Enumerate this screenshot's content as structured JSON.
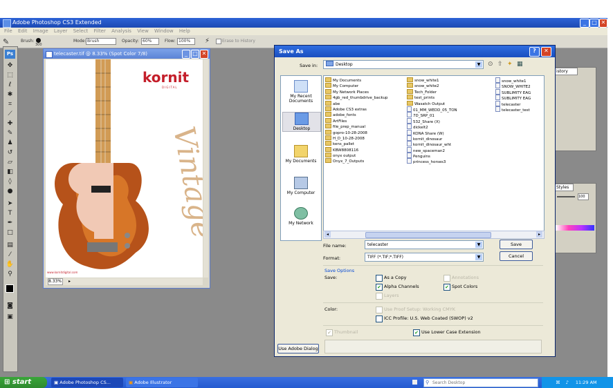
{
  "app": {
    "title": "Adobe Photoshop CS3 Extended",
    "menus": [
      "File",
      "Edit",
      "Image",
      "Layer",
      "Select",
      "Filter",
      "Analysis",
      "View",
      "Window",
      "Help"
    ],
    "options_bar": {
      "brush_label": "Brush:",
      "brush_size": "300",
      "mode_label": "Mode:",
      "mode_value": "Brush",
      "opacity_label": "Opacity:",
      "opacity_value": "60%",
      "flow_label": "Flow:",
      "flow_value": "100%",
      "erase_history_label": "Erase to History"
    },
    "ps_badge": "Ps"
  },
  "document": {
    "title": "telecaster.tif @ 8.33% (Spot Color 7/8)",
    "zoom": "8.33%",
    "brand_text": "kornit",
    "brand_sub": "DIGITAL",
    "script_text": "Vintage",
    "footer_url": "www.kornitdigital.com"
  },
  "dialog": {
    "title": "Save As",
    "save_in_label": "Save in:",
    "save_in_value": "Desktop",
    "places": [
      "My Recent Documents",
      "Desktop",
      "My Documents",
      "My Computer",
      "My Network"
    ],
    "files_col1": [
      "My Documents",
      "My Computer",
      "My Network Places",
      "4gb_red_thumbdrive_backup",
      "abe",
      "Adobe CS3 extras",
      "adobe_fonts",
      "ArtFiles",
      "file_prep_manual",
      "gopro-10-28-2008",
      "H_D_10-28-2008",
      "kens_pallet",
      "KBW8808116",
      "onyx output",
      "Onyx_7_Outputs"
    ],
    "files_col1_types": [
      "fold",
      "fold",
      "fold",
      "fold",
      "fold",
      "fold",
      "fold",
      "fold",
      "fold",
      "fold",
      "fold",
      "fold",
      "fold",
      "fold",
      "fold"
    ],
    "files_col2": [
      "snow_white1",
      "snow_white2",
      "Tech_Folder",
      "test_prints",
      "Wasatch Output",
      "01_MM_WEDD_05_TON",
      "7D_SRP_01",
      "532_Share (X)",
      "dickelt2",
      "KONA Share (W)",
      "kornit_dinosaur",
      "kornit_dinosaur_wht",
      "new_spaceman2",
      "Penguins",
      "princess_horses3"
    ],
    "files_col2_types": [
      "fold",
      "fold",
      "fold",
      "fold",
      "fold",
      "file",
      "file",
      "file",
      "file",
      "file",
      "file",
      "file",
      "file",
      "file",
      "file"
    ],
    "files_col3": [
      "snow_white1",
      "SNOW_WHITE2",
      "SUBLIMITY EAG",
      "SUBLIMITY EAG",
      "telecaster",
      "telecaster_test"
    ],
    "file_name_label": "File name:",
    "file_name_value": "telecaster",
    "format_label": "Format:",
    "format_value": "TIFF (*.TIF;*.TIFF)",
    "save_button": "Save",
    "cancel_button": "Cancel",
    "save_options_label": "Save Options",
    "save_label": "Save:",
    "as_a_copy": "As a Copy",
    "annotations": "Annotations",
    "alpha_channels": "Alpha Channels",
    "spot_colors": "Spot Colors",
    "layers": "Layers",
    "color_label": "Color:",
    "use_proof_setup": "Use Proof Setup:  Working CMYK",
    "icc_profile": "ICC Profile:  U.S. Web Coated (SWOP) v2",
    "thumbnail": "Thumbnail",
    "lower_case_ext": "Use Lower Case Extension",
    "use_adobe_dialog": "Use Adobe Dialog"
  },
  "panels": {
    "panel1_tab": "istory",
    "panel2_tab": "Styles",
    "panel2_value": "100"
  },
  "taskbar": {
    "start": "start",
    "task1": "Adobe Photoshop CS...",
    "task2": "Adobe Illustrator",
    "search_placeholder": "Search Desktop",
    "clock": "11:29 AM"
  },
  "colors": {
    "xp_blue": "#245ad0",
    "kornit_red": "#c41e2a",
    "vintage_tan": "#d9b48a",
    "guitar_orange": "#c4611c"
  }
}
